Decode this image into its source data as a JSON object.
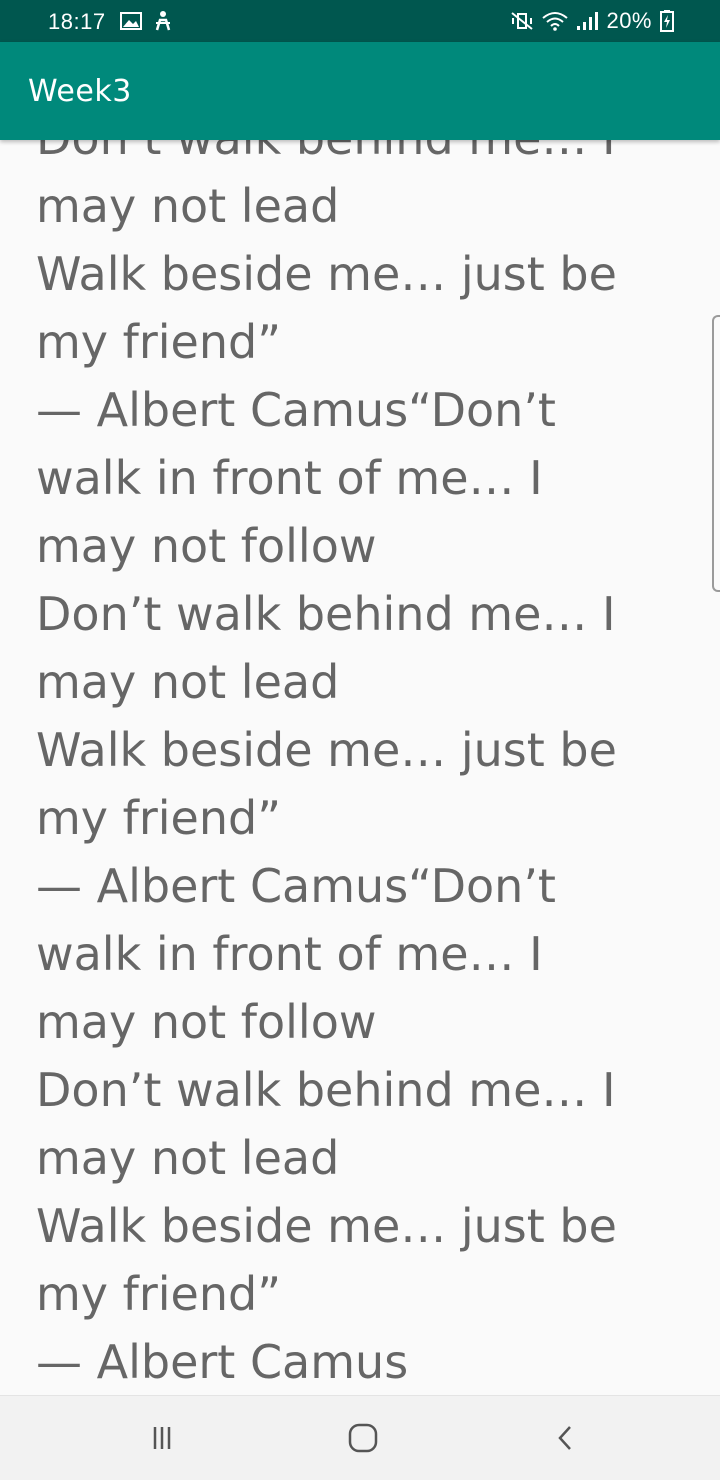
{
  "status_bar": {
    "time": "18:17",
    "battery_percent": "20%",
    "left_icons": [
      "gallery-icon",
      "accessibility-icon"
    ],
    "right_icons": [
      "mute-vibrate-icon",
      "wifi-icon",
      "signal-icon",
      "battery-charging-icon"
    ]
  },
  "app_bar": {
    "title": "Week3"
  },
  "content": {
    "lines": [
      "Don’t walk behind me… I",
      "may not lead",
      "Walk beside me… just be",
      "my friend”",
      "— Albert Camus“Don’t",
      "walk in front of me… I",
      "may not follow",
      "Don’t walk behind me… I",
      "may not lead",
      "Walk beside me… just be",
      "my friend”",
      "— Albert Camus“Don’t",
      "walk in front of me… I",
      "may not follow",
      "Don’t walk behind me… I",
      "may not lead",
      "Walk beside me… just be",
      "my friend”",
      "— Albert Camus"
    ]
  },
  "nav_bar": {
    "buttons": [
      "recents-icon",
      "home-icon",
      "back-icon"
    ]
  },
  "colors": {
    "status_bar": "#00574f",
    "app_bar": "#00897b",
    "text": "#666666",
    "background": "#fafafa",
    "nav_bar": "#f2f2f2"
  }
}
